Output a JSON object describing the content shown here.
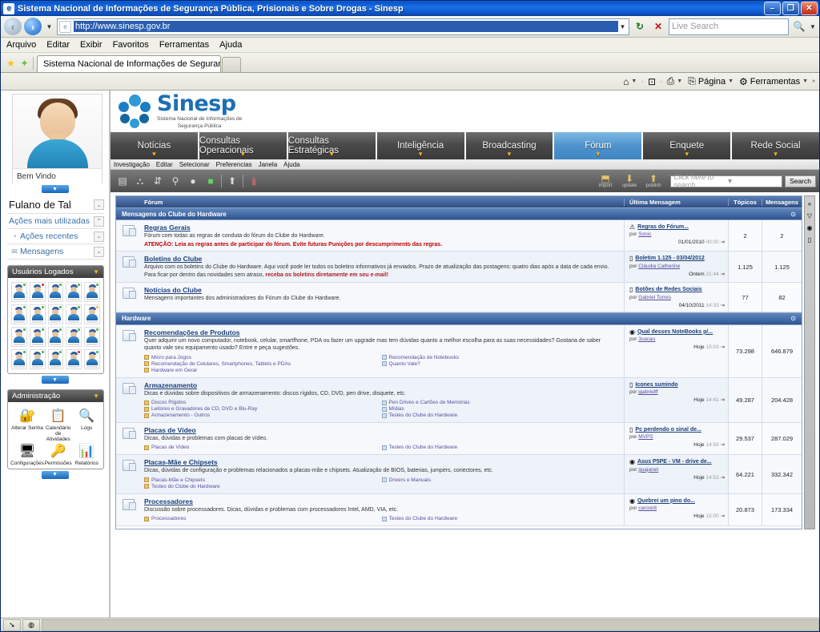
{
  "window": {
    "title": "Sistema Nacional de Informações de Segurança Pública, Prisionais e Sobre Drogas - Sinesp",
    "app_icon": "ie-icon",
    "minimize": "–",
    "restore": "❐",
    "close": "✕"
  },
  "address_bar": {
    "back_icon": "back-arrow",
    "forward_icon": "forward-arrow",
    "url": "http://www.sinesp.gov.br",
    "refresh_icon": "↻",
    "stop_icon": "✕",
    "search_placeholder": "Live Search",
    "search_icon": "🔍"
  },
  "menubar": {
    "items": [
      "Arquivo",
      "Editar",
      "Exibir",
      "Favoritos",
      "Ferramentas",
      "Ajuda"
    ]
  },
  "browser_tabs": {
    "favorites_star": "★",
    "add_favorite": "✦",
    "tabs": [
      "Sistema Nacional de Informações de Segurança Pública, Pris"
    ]
  },
  "command_bar": {
    "items": [
      {
        "icon": "home-icon",
        "glyph": "⌂",
        "label": "",
        "caret": true
      },
      {
        "icon": "feeds-icon",
        "glyph": "⊡",
        "label": "",
        "caret": false
      },
      {
        "icon": "print-icon",
        "glyph": "⎙",
        "label": "",
        "caret": true
      },
      {
        "icon": "page-icon",
        "glyph": "⎘",
        "label": "Página",
        "caret": true
      },
      {
        "icon": "tools-icon",
        "glyph": "⚙",
        "label": "Ferramentas",
        "caret": true
      }
    ],
    "overflow": "»"
  },
  "sidebar": {
    "avatar": {
      "name": "avatar",
      "welcome": "Bem Vindo"
    },
    "account": {
      "user_name": "Fulano de Tal"
    },
    "links": [
      {
        "label": "Ações mais utilizadas",
        "icon": "",
        "chevron": "⌃"
      },
      {
        "label": "Ações recentes",
        "icon": "◔",
        "chevron": "⌄"
      },
      {
        "label": "Mensagens",
        "icon": "✉",
        "chevron": "⌄"
      }
    ],
    "users_panel": {
      "title": "Usuários Logados",
      "collapse_icon": "▼",
      "user_count": 20,
      "statuses": [
        "g",
        "r",
        "g",
        "g",
        "g",
        "g",
        "g",
        "g",
        "g",
        "y",
        "g",
        "g",
        "g",
        "g",
        "g",
        "g",
        "g",
        "g",
        "r",
        "g"
      ]
    },
    "admin_panel": {
      "title": "Administração",
      "collapse_icon": "▼",
      "items": [
        {
          "label": "Alterar Senha",
          "icon": "key-icon",
          "glyph": "🔐"
        },
        {
          "label": "Calendário de Atividades",
          "icon": "calendar-icon",
          "glyph": "📋"
        },
        {
          "label": "Logs",
          "icon": "magnifier-icon",
          "glyph": "🔍"
        },
        {
          "label": "Configurações",
          "icon": "monitor-gear-icon",
          "glyph": "🖥"
        },
        {
          "label": "Permissões",
          "icon": "keys-icon",
          "glyph": "🔑"
        },
        {
          "label": "Relatórios",
          "icon": "report-chart-icon",
          "glyph": "📊"
        }
      ]
    }
  },
  "brand": {
    "name": "Sinesp",
    "subtitle_line1": "Sistema Nacional de Informações de",
    "subtitle_line2": "Segurança Pública",
    "logo_icon": "sinesp-logo"
  },
  "nav_tabs": [
    {
      "label": "Notícias",
      "active": false
    },
    {
      "label": "Consultas Operacionais",
      "active": false
    },
    {
      "label": "Consultas Estratégicas",
      "active": false
    },
    {
      "label": "Inteligência",
      "active": false
    },
    {
      "label": "Broadcasting",
      "active": false
    },
    {
      "label": "Fórum",
      "active": true
    },
    {
      "label": "Enquete",
      "active": false
    },
    {
      "label": "Rede Social",
      "active": false
    }
  ],
  "app_menu": {
    "items": [
      "Investigação",
      "Editar",
      "Selecionar",
      "Preferencias",
      "Janela",
      "Ajuda"
    ]
  },
  "app_toolbar": {
    "tools": [
      {
        "icon": "document-icon",
        "glyph": "▤"
      },
      {
        "icon": "network-icon",
        "glyph": "⛬"
      },
      {
        "icon": "link-icon",
        "glyph": "⇵"
      },
      {
        "icon": "search-person-icon",
        "glyph": "⚲"
      },
      {
        "icon": "comment-icon",
        "glyph": "●"
      },
      {
        "icon": "green-status-icon",
        "glyph": "■"
      },
      {
        "icon": "export-icon",
        "glyph": "⬆"
      },
      {
        "icon": "red-icon",
        "glyph": "▮"
      }
    ],
    "actions": [
      {
        "label": "import",
        "icon": "import-icon",
        "glyph": "⬒"
      },
      {
        "label": "update",
        "icon": "update-icon",
        "glyph": "⬇"
      },
      {
        "label": "publish",
        "icon": "publish-icon",
        "glyph": "⬆"
      }
    ],
    "search_placeholder": "Click here to search",
    "search_button": "Search"
  },
  "forum": {
    "headers": {
      "forum": "Fórum",
      "last_message": "Última Mensagem",
      "topics": "Tópicos",
      "messages": "Mensagens"
    },
    "sections": [
      {
        "title": "Mensagens do Clube do Hardware",
        "rows": [
          {
            "title": "Regras Gerais",
            "desc": "Fórum com todas as regras de conduta do fórum do Clube do Hardware.",
            "warning": "ATENÇÃO: Leia as regras antes de participar do fórum. Evite futuras Punições por descumprimento das regras.",
            "sublinks_left": [],
            "sublinks_right": [],
            "last": {
              "icon": "warning-icon",
              "glyph": "⚠",
              "title": "Regras do Fórum...",
              "by": "por",
              "author": "Sonic",
              "date": "01/01/2010",
              "time": "00:00"
            },
            "topics": "2",
            "messages": "2"
          },
          {
            "title": "Boletins do Clube",
            "desc": "Arquivo com os boletins do Clube do Hardware. Aqui você pode ler todos os boletins informativos já enviados. Prazo de atualização das postagens: quatro dias após a data de cada envio.",
            "desc2_pre": "Para ficar por dentro das novidades sem atraso, ",
            "desc2_hl": "receba os boletins diretamente em seu e-mail!",
            "sublinks_left": [],
            "sublinks_right": [],
            "last": {
              "icon": "post-icon",
              "glyph": "▯",
              "title": "Boletim 1.125 - 03/04/2012",
              "by": "por",
              "author": "Cláudia Catherine",
              "date": "Ontem",
              "time": "21:44"
            },
            "topics": "1.125",
            "messages": "1.125"
          },
          {
            "title": "Notícias do Clube",
            "desc": "Mensagens importantes dos administradores do Fórum do Clube do Hardware.",
            "sublinks_left": [],
            "sublinks_right": [],
            "last": {
              "icon": "post-icon",
              "glyph": "▯",
              "title": "Botões de Redes Sociais",
              "by": "por",
              "author": "Gabriel Torres",
              "date": "04/10/2011",
              "time": "14:33"
            },
            "topics": "77",
            "messages": "82"
          }
        ]
      },
      {
        "title": "Hardware",
        "rows": [
          {
            "title": "Recomendações de Produtos",
            "desc": "Quer adquirir um novo computador, notebook, celular, smartfhone, PDA ou fazer um upgrade mas tem dúvidas quanto a melhor escolha para as suas necessidades? Gostaria de saber quanto vale seu equipamento usado? Entre e peça sugestões.",
            "sublinks_left": [
              "Micro para Jogos",
              "Recomendação de Celulares, Smartphones, Tablets e PDAs",
              "Hardware em Geral"
            ],
            "sublinks_right": [
              "Recomendação de Notebooks",
              "Quanto Vale?"
            ],
            "last": {
              "icon": "blue-post-icon",
              "glyph": "◉",
              "title": "Qual desses NoteBooks p/...",
              "by": "por",
              "author": "3cacao",
              "date": "Hoje",
              "time": "15:03"
            },
            "topics": "73.298",
            "messages": "646.879"
          },
          {
            "title": "Armazenamento",
            "desc": "Dicas e dúvidas sobre dispositivos de armazenamento: discos rígidos, CD, DVD, pen drive, disquete, etc.",
            "sublinks_left": [
              "Discos Rígidos",
              "Leitores e Gravadores de CD, DVD e Blu-Ray",
              "Armazenamento - Outros"
            ],
            "sublinks_right": [
              "Pen Drives e Cartões de Memórias",
              "Mídias",
              "Testes do Clube do Hardware"
            ],
            "last": {
              "icon": "post-icon",
              "glyph": "▯",
              "title": "Icones sumindo",
              "by": "por",
              "author": "jgabrielff",
              "date": "Hoje",
              "time": "14:41"
            },
            "topics": "49.287",
            "messages": "204.428"
          },
          {
            "title": "Placas de Vídeo",
            "desc": "Dicas, dúvidas e problemas com placas de vídeo.",
            "sublinks_left": [
              "Placas de Vídeo"
            ],
            "sublinks_right": [
              "Testes do Clube do Hardware"
            ],
            "last": {
              "icon": "post-icon",
              "glyph": "▯",
              "title": "Pc perdendo o sinal de...",
              "by": "por",
              "author": "MVPS",
              "date": "Hoje",
              "time": "14:59"
            },
            "topics": "29.537",
            "messages": "287.029"
          },
          {
            "title": "Placas-Mãe e Chipsets",
            "desc": "Dicas, dúvidas de configuração e problemas relacionados a placas-mãe e chipsets. Atualização de BIOS, baterias, jumpers, conectores, etc.",
            "sublinks_left": [
              "Placas-Mãe e Chipsets",
              "Testes do Clube do Hardware"
            ],
            "sublinks_right": [
              "Drivers e Manuais"
            ],
            "last": {
              "icon": "blue-post-icon",
              "glyph": "◉",
              "title": "Asus P5PE - VM - drive de...",
              "by": "por",
              "author": "guajanet",
              "date": "Hoje",
              "time": "14:53"
            },
            "topics": "64.221",
            "messages": "332.342"
          },
          {
            "title": "Processadores",
            "desc": "Discussão sobre processadores. Dicas, dúvidas e problemas com processadores Intel, AMD, VIA, etc.",
            "sublinks_left": [
              "Processadores"
            ],
            "sublinks_right": [
              "Testes do Clube do Hardware"
            ],
            "last": {
              "icon": "blue-post-icon",
              "glyph": "◉",
              "title": "Quebrei um pino do...",
              "by": "por",
              "author": "carosk8",
              "date": "Hoje",
              "time": "15:00"
            },
            "topics": "20.873",
            "messages": "173.334"
          }
        ]
      }
    ],
    "side_scroll": [
      {
        "icon": "collapse-icon",
        "glyph": "«"
      },
      {
        "icon": "bookmark-yellow-icon",
        "glyph": "▽"
      },
      {
        "icon": "target-icon",
        "glyph": "◉"
      },
      {
        "icon": "bookmark-orange-icon",
        "glyph": "▯"
      }
    ]
  },
  "statusbar": {
    "cells": [
      {
        "icon": "pointer-icon",
        "glyph": "➘"
      },
      {
        "icon": "globe-icon",
        "glyph": "🌐"
      }
    ]
  },
  "colors": {
    "accent_blue": "#1c6fb5",
    "tab_active": "#4e93cc",
    "forum_header": "#2e4f86",
    "warning_red": "#c00000",
    "link_purple": "#5a4fa0"
  }
}
